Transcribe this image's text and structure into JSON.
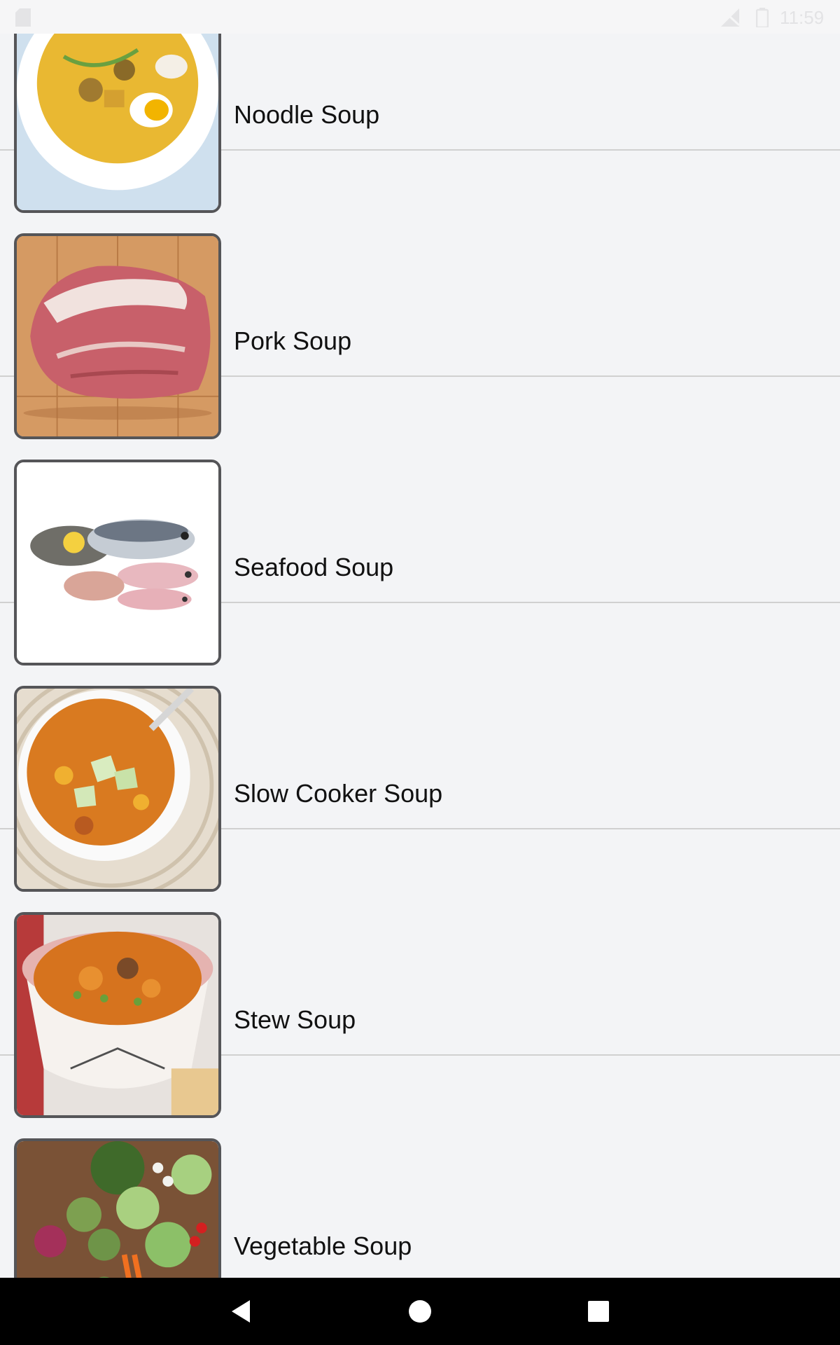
{
  "status_bar": {
    "time": "11:59",
    "icons": [
      "sd-card-icon",
      "no-signal-icon",
      "battery-icon"
    ]
  },
  "soups": [
    {
      "label": "Noodle Soup",
      "image": "noodle-soup-image"
    },
    {
      "label": "Pork Soup",
      "image": "pork-soup-image"
    },
    {
      "label": "Seafood Soup",
      "image": "seafood-soup-image"
    },
    {
      "label": "Slow Cooker Soup",
      "image": "slow-cooker-soup-image"
    },
    {
      "label": "Stew Soup",
      "image": "stew-soup-image"
    },
    {
      "label": "Vegetable Soup",
      "image": "vegetable-soup-image"
    }
  ],
  "nav_bar": {
    "buttons": [
      "back-icon",
      "home-icon",
      "recents-icon"
    ]
  },
  "colors": {
    "background": "#f3f4f6",
    "divider": "#d0d0d0",
    "thumb_border": "#555558",
    "nav_bar": "#000000"
  }
}
